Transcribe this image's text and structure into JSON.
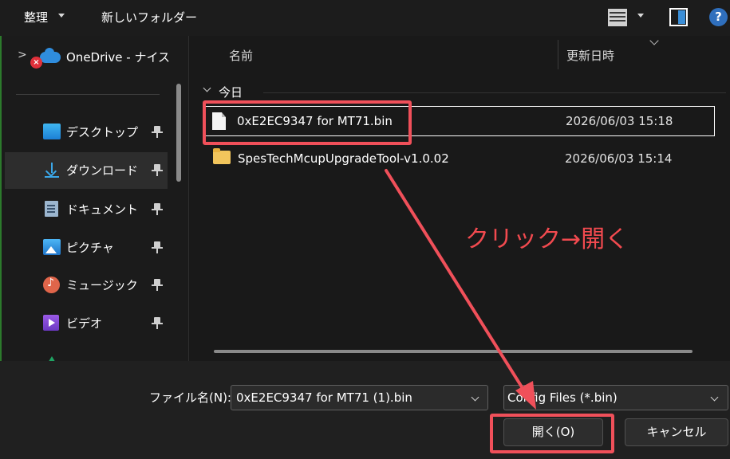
{
  "toolbar": {
    "organize_label": "整理",
    "new_folder_label": "新しいフォルダー",
    "help_label": "?"
  },
  "sidebar": {
    "onedrive_label": "OneDrive - ナイス",
    "items": [
      {
        "label": "デスクトップ",
        "icon": "desktop-icon",
        "pinned": true
      },
      {
        "label": "ダウンロード",
        "icon": "download-icon",
        "pinned": true,
        "selected": true
      },
      {
        "label": "ドキュメント",
        "icon": "documents-icon",
        "pinned": true
      },
      {
        "label": "ピクチャ",
        "icon": "pictures-icon",
        "pinned": true
      },
      {
        "label": "ミュージック",
        "icon": "music-icon",
        "pinned": true
      },
      {
        "label": "ビデオ",
        "icon": "videos-icon",
        "pinned": true
      }
    ]
  },
  "file_list": {
    "columns": {
      "name": "名前",
      "modified": "更新日時"
    },
    "group_label": "今日",
    "rows": [
      {
        "name": "0xE2EC9347 for MT71.bin",
        "modified": "2026/06/03 15:18",
        "type": "file",
        "highlighted": true
      },
      {
        "name": "SpesTechMcupUpgradeTool-v1.0.02",
        "modified": "2026/06/03 15:14",
        "type": "folder"
      }
    ]
  },
  "annotation": {
    "text": "クリック→開く",
    "color": "#f24a4f"
  },
  "bottom": {
    "filename_label": "ファイル名(N):",
    "filename_value": "0xE2EC9347 for MT71 (1).bin",
    "filetype_value": "Config Files (*.bin)",
    "open_label": "開く(O)",
    "cancel_label": "キャンセル"
  },
  "colors": {
    "background": "#191919",
    "accent": "#2f6fbd",
    "highlight": "#f0505a"
  }
}
